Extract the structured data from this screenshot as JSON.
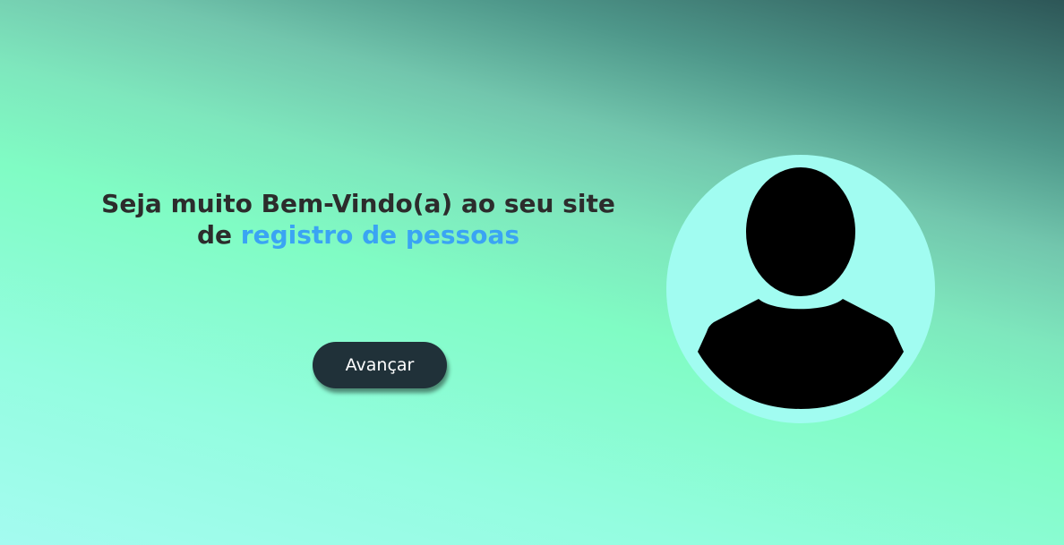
{
  "welcome": {
    "line_prefix": "Seja muito Bem-Vindo(a) ao seu site",
    "connector": "de",
    "highlight": "registro de pessoas"
  },
  "actions": {
    "advance_label": "Avançar"
  },
  "avatar": {
    "icon": "user-silhouette-icon"
  },
  "colors": {
    "highlight": "#3aa4f3",
    "button_bg": "#203139",
    "avatar_circle": "#a1fcf1"
  }
}
